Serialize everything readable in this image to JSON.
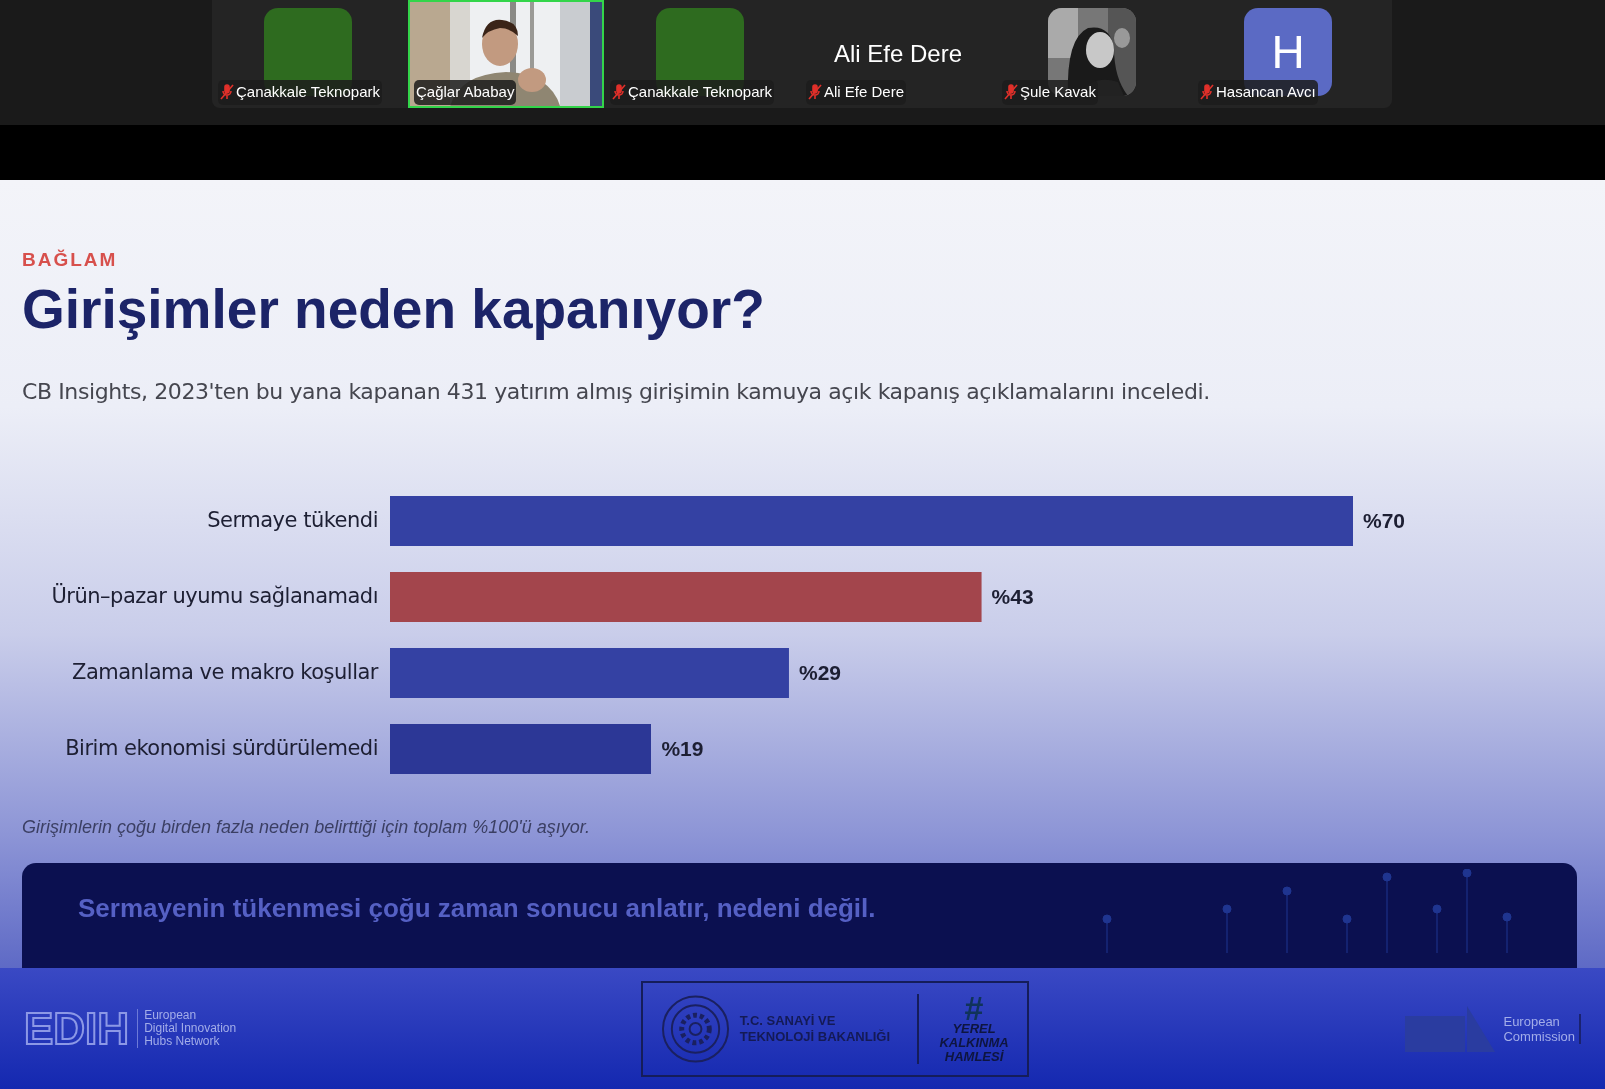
{
  "participants": [
    {
      "name": "Çanakkale Teknopark",
      "kind": "avatar",
      "muted": true,
      "speaking": false,
      "color": "#2e6b1f"
    },
    {
      "name": "Çağlar Ababay",
      "kind": "video",
      "muted": false,
      "speaking": true
    },
    {
      "name": "Çanakkale Teknopark",
      "kind": "avatar",
      "muted": true,
      "speaking": false,
      "color": "#2e6b1f"
    },
    {
      "name": "Ali Efe Dere",
      "kind": "name",
      "muted": true,
      "speaking": false,
      "display": "Ali Efe Dere"
    },
    {
      "name": "Şule Kavak",
      "muted": true,
      "speaking": false
    },
    {
      "name": "Hasancan Avcı",
      "kind": "initial",
      "muted": true,
      "speaking": false,
      "initial": "H",
      "color": "#5b6ac4"
    }
  ],
  "slide": {
    "eyebrow": "BAĞLAM",
    "title": "Girişimler neden kapanıyor?",
    "subtitle": "CB Insights, 2023'ten bu yana kapanan 431 yatırım almış girişimin kamuya açık kapanış açıklamalarını inceledi.",
    "chart_data": {
      "type": "bar",
      "orientation": "horizontal",
      "categories": [
        "Sermaye tükendi",
        "Ürün–pazar uyumu sağlanamadı",
        "Zamanlama ve makro koşullar",
        "Birim ekonomisi sürdürülemedi"
      ],
      "series": [
        {
          "color": "#3441a3",
          "values": [
            70,
            null,
            29,
            null
          ],
          "value_labels": [
            "%70",
            null,
            "%29",
            null
          ]
        },
        {
          "color": "#a3454c",
          "values": [
            null,
            43,
            null,
            null
          ],
          "value_labels": [
            null,
            "%43",
            null,
            null
          ]
        },
        {
          "color": "#2c3796",
          "values": [
            null,
            null,
            null,
            19
          ],
          "value_labels": [
            null,
            null,
            null,
            "%19"
          ]
        }
      ]
    },
    "note": "Girişimlerin çoğu birden fazla neden belirttiği için toplam %100'ü aşıyor.",
    "callout": "Sermayenin tükenmesi çoğu zaman sonucu anlatır, nedeni değil."
  },
  "footer": {
    "edih_mark": "EDIH",
    "edih_text": [
      "European",
      "Digital Innovation",
      "Hubs Network"
    ],
    "ministry": [
      "T.C. SANAYİ VE",
      "TEKNOLOJİ BAKANLIĞI"
    ],
    "campaign": [
      "YEREL",
      "KALKINMA",
      "HAMLESİ"
    ],
    "campaign_mark": "#",
    "eu_text": [
      "European",
      "Commission"
    ]
  }
}
